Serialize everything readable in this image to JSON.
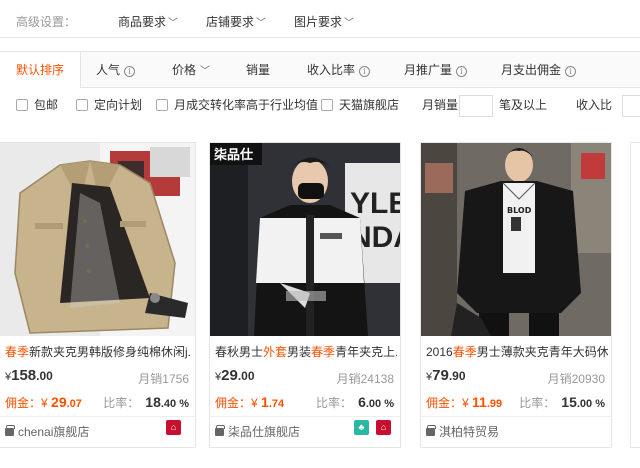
{
  "filters": {
    "label": "高级设置：",
    "items": [
      "商品要求",
      "店铺要求",
      "图片要求"
    ]
  },
  "sort": {
    "items": [
      {
        "label": "默认排序",
        "active": true
      },
      {
        "label": "人气",
        "info": true
      },
      {
        "label": "价格",
        "dropdown": true
      },
      {
        "label": "销量"
      },
      {
        "label": "收入比率",
        "info": true
      },
      {
        "label": "月推广量",
        "info": true
      },
      {
        "label": "月支出佣金",
        "info": true
      }
    ]
  },
  "options": {
    "free_shipping": "包邮",
    "targeted_plan": "定向计划",
    "conversion_above_avg": "月成交转化率高于行业均值",
    "tmall_flagship": "天猫旗舰店",
    "monthly_sales_label": "月销量",
    "monthly_sales_suffix": "笔及以上",
    "income_ratio_label": "收入比"
  },
  "products": [
    {
      "title_pre": "",
      "title_hl": "春季",
      "title_post": "新款夹克男韩版修身纯棉休闲j...",
      "price_int": "158",
      "price_dec": ".00",
      "sales_label": "月销",
      "sales": "1756",
      "commission_label": "佣金：",
      "commission_int": "29",
      "commission_dec": ".07",
      "ratio_label": "比率：",
      "ratio_int": "18",
      "ratio_dec": ".40 %",
      "shop": "chenai旗舰店",
      "badge": "tmall"
    },
    {
      "title_pre": "春秋男士",
      "title_hl": "外套",
      "title_mid": "男装",
      "title_hl2": "春季",
      "title_post": "青年夹克上...",
      "price_int": "29",
      "price_dec": ".00",
      "sales_label": "月销",
      "sales": "24138",
      "commission_label": "佣金：",
      "commission_int": "1",
      "commission_dec": ".74",
      "ratio_label": "比率：",
      "ratio_int": "6",
      "ratio_dec": ".00 %",
      "shop": "柒品仕旗舰店",
      "badge": "tmall"
    },
    {
      "title_pre": "2016",
      "title_hl": "春季",
      "title_post": "男士薄款夹克青年大码休...",
      "price_int": "79",
      "price_dec": ".90",
      "sales_label": "月销",
      "sales": "20930",
      "commission_label": "佣金：",
      "commission_int": "11",
      "commission_dec": ".99",
      "ratio_label": "比率：",
      "ratio_int": "15",
      "ratio_dec": ".00 %",
      "shop": "淇柏特贸易",
      "badge": ""
    }
  ],
  "image_text": {
    "brand_logo": "柒品仕",
    "bg_letters": "YLE\nNDA",
    "tee_print": "BLOD"
  },
  "colors": {
    "accent": "#ff5000",
    "tmall_red": "#c8102e",
    "mobile_green": "#2ab7a3"
  },
  "symbols": {
    "yen": "¥",
    "chevron": "﹀",
    "info": "i",
    "tmall_glyph": "⌂",
    "mobile_glyph": "♣"
  }
}
